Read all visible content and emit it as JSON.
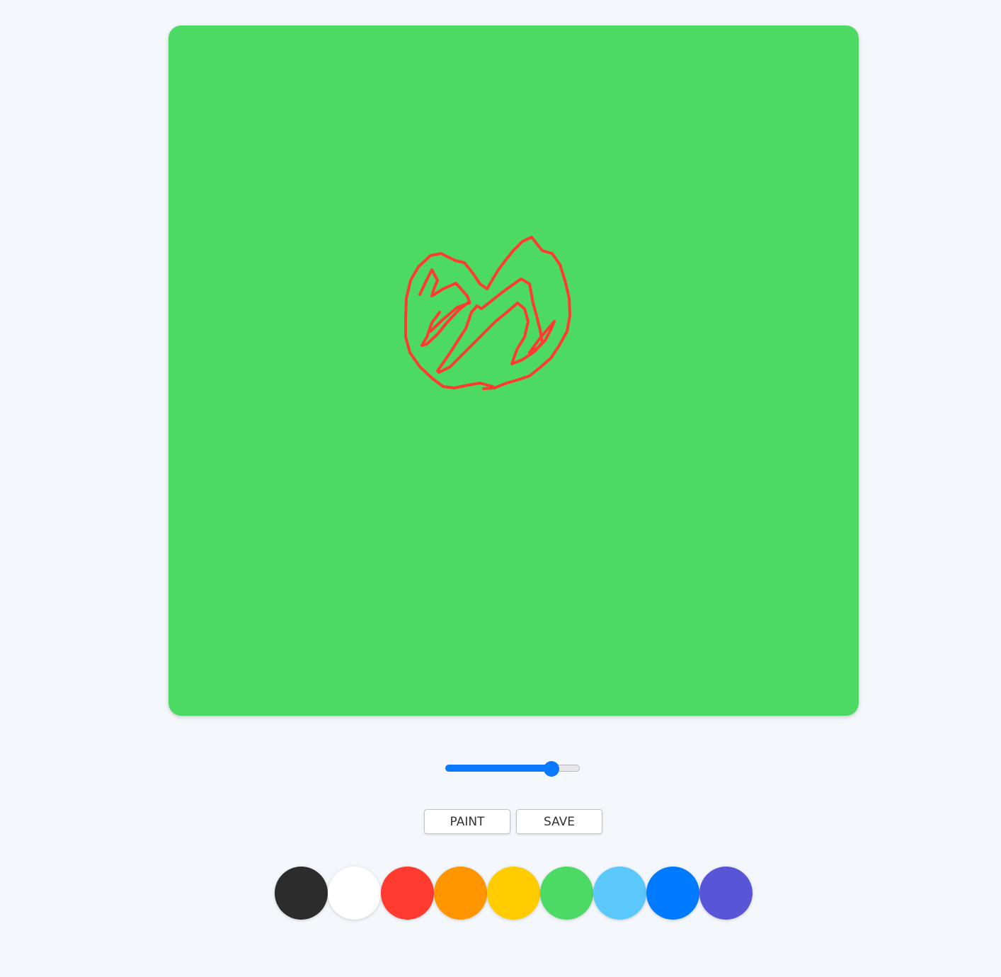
{
  "canvas": {
    "background_color": "#4cd964",
    "stroke_color": "#ff3b30"
  },
  "brush_size": {
    "fraction": 0.79
  },
  "toolbar": {
    "paint_label": "PAINT",
    "save_label": "SAVE"
  },
  "palette": {
    "colors": [
      "#2c2c2c",
      "#ffffff",
      "#ff3b30",
      "#ff9500",
      "#ffcc00",
      "#4cd964",
      "#5ac8fa",
      "#007aff",
      "#5856d6"
    ]
  }
}
